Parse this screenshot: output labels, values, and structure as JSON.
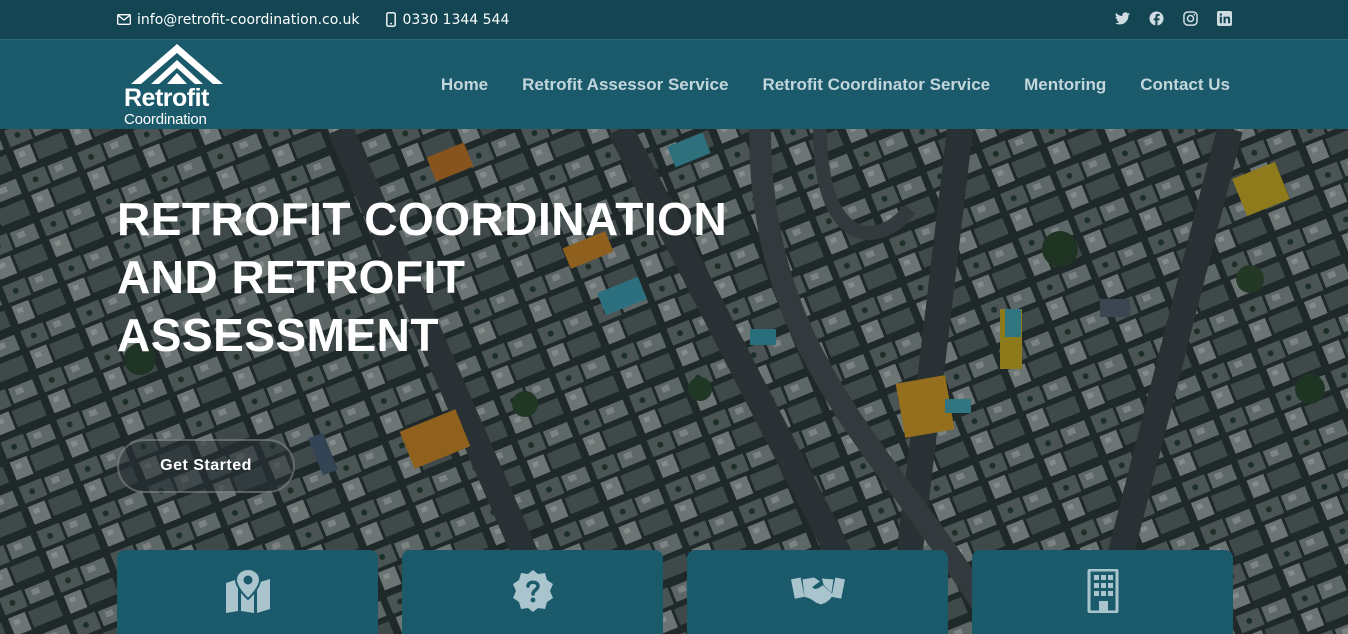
{
  "topbar": {
    "email": "info@retrofit-coordination.co.uk",
    "phone": "0330 1344 544",
    "social_icons": [
      "twitter-icon",
      "facebook-icon",
      "instagram-icon",
      "linkedin-icon"
    ]
  },
  "logo": {
    "line1": "Retrofit",
    "line2": "Coordination"
  },
  "nav": {
    "items": [
      "Home",
      "Retrofit Assessor Service",
      "Retrofit Coordinator Service",
      "Mentoring",
      "Contact Us"
    ]
  },
  "hero": {
    "headline": "Retrofit Coordination and Retrofit Assessment",
    "cta_label": "Get Started"
  },
  "cards": {
    "icons": [
      "map-icon",
      "question-badge-icon",
      "handshake-icon",
      "building-icon"
    ]
  },
  "colors": {
    "topbar": "#134553",
    "navbar": "#1b5a6b",
    "card": "#1b5a6b",
    "nav_text": "#c3d6dc"
  }
}
